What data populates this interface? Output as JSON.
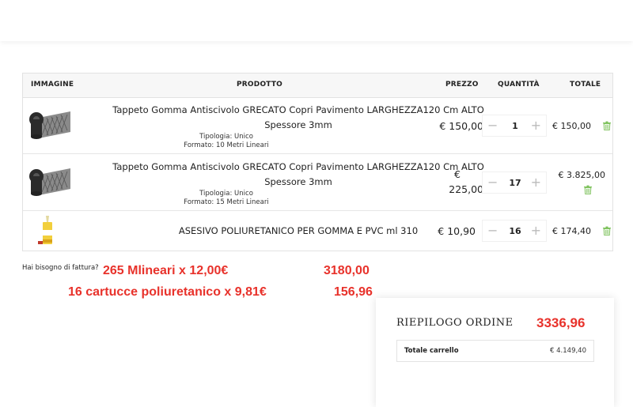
{
  "table": {
    "headers": {
      "image": "IMMAGINE",
      "product": "PRODOTTO",
      "price": "PREZZO",
      "quantity": "QUANTITÀ",
      "total": "TOTALE"
    },
    "rows": [
      {
        "name_line1": "Tappeto Gomma Antiscivolo GRECATO Copri Pavimento LARGHEZZA120 Cm ALTO",
        "name_line2": "Spessore 3mm",
        "tipologia": "Tipologia: Unico",
        "formato": "Formato: 10 Metri Lineari",
        "price": "€ 150,00",
        "qty": "1",
        "total": "€ 150,00",
        "image_icon": "rubber-mat-roll-icon"
      },
      {
        "name_line1": "Tappeto Gomma Antiscivolo GRECATO Copri Pavimento LARGHEZZA120 Cm ALTO",
        "name_line2": "Spessore 3mm",
        "tipologia": "Tipologia: Unico",
        "formato": "Formato: 15 Metri Lineari",
        "price_line1": "€",
        "price_line2": "225,00",
        "qty": "17",
        "total": "€ 3.825,00",
        "image_icon": "rubber-mat-roll-icon"
      },
      {
        "name_line1": "ASESIVO POLIURETANICO PER GOMMA E PVC ml 310",
        "price": "€ 10,90",
        "qty": "16",
        "total": "€ 174,40",
        "image_icon": "adhesive-cartridge-icon"
      }
    ],
    "qty_minus": "−",
    "qty_plus": "+"
  },
  "invoice_text": "Hai bisogno di fattura?",
  "annotations": {
    "line1_left": "265 Mlineari x 12,00€",
    "line1_right": "3180,00",
    "line2_left": "16 cartucce poliuretanico x 9,81€",
    "line2_right": "156,96",
    "summary_total": "3336,96",
    "color": "#e8322b"
  },
  "summary": {
    "title": "RIEPILOGO ORDINE",
    "cart_total_label": "Totale carrello",
    "cart_total_value": "€ 4.149,40"
  },
  "colors": {
    "trash_icon": "#7cc15a",
    "header_bg": "#f7f7f7"
  }
}
